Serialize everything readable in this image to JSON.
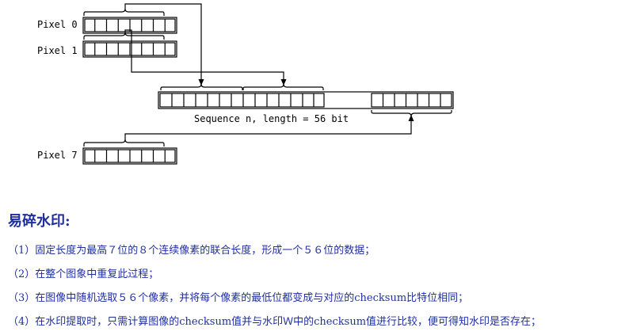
{
  "diagram": {
    "pixel0_label": "Pixel 0",
    "pixel1_label": "Pixel 1",
    "pixel7_label": "Pixel 7",
    "sequence_label": "Sequence n, length = 56 bit"
  },
  "notes": {
    "heading": "易碎水印:",
    "items": [
      "（1）固定长度为最高７位的８个连续像素的联合长度，形成一个５６位的数据；",
      "（2）在整个图象中重复此过程；",
      "（3）在图像中随机选取５６个像素，并将每个像素的最低位都变成与对应的checksum比特位相同；",
      "（4）在水印提取时，只需计算图像的checksum值并与水印Ｗ中的checksum值进行比较，便可得知水印是否存在；"
    ]
  }
}
